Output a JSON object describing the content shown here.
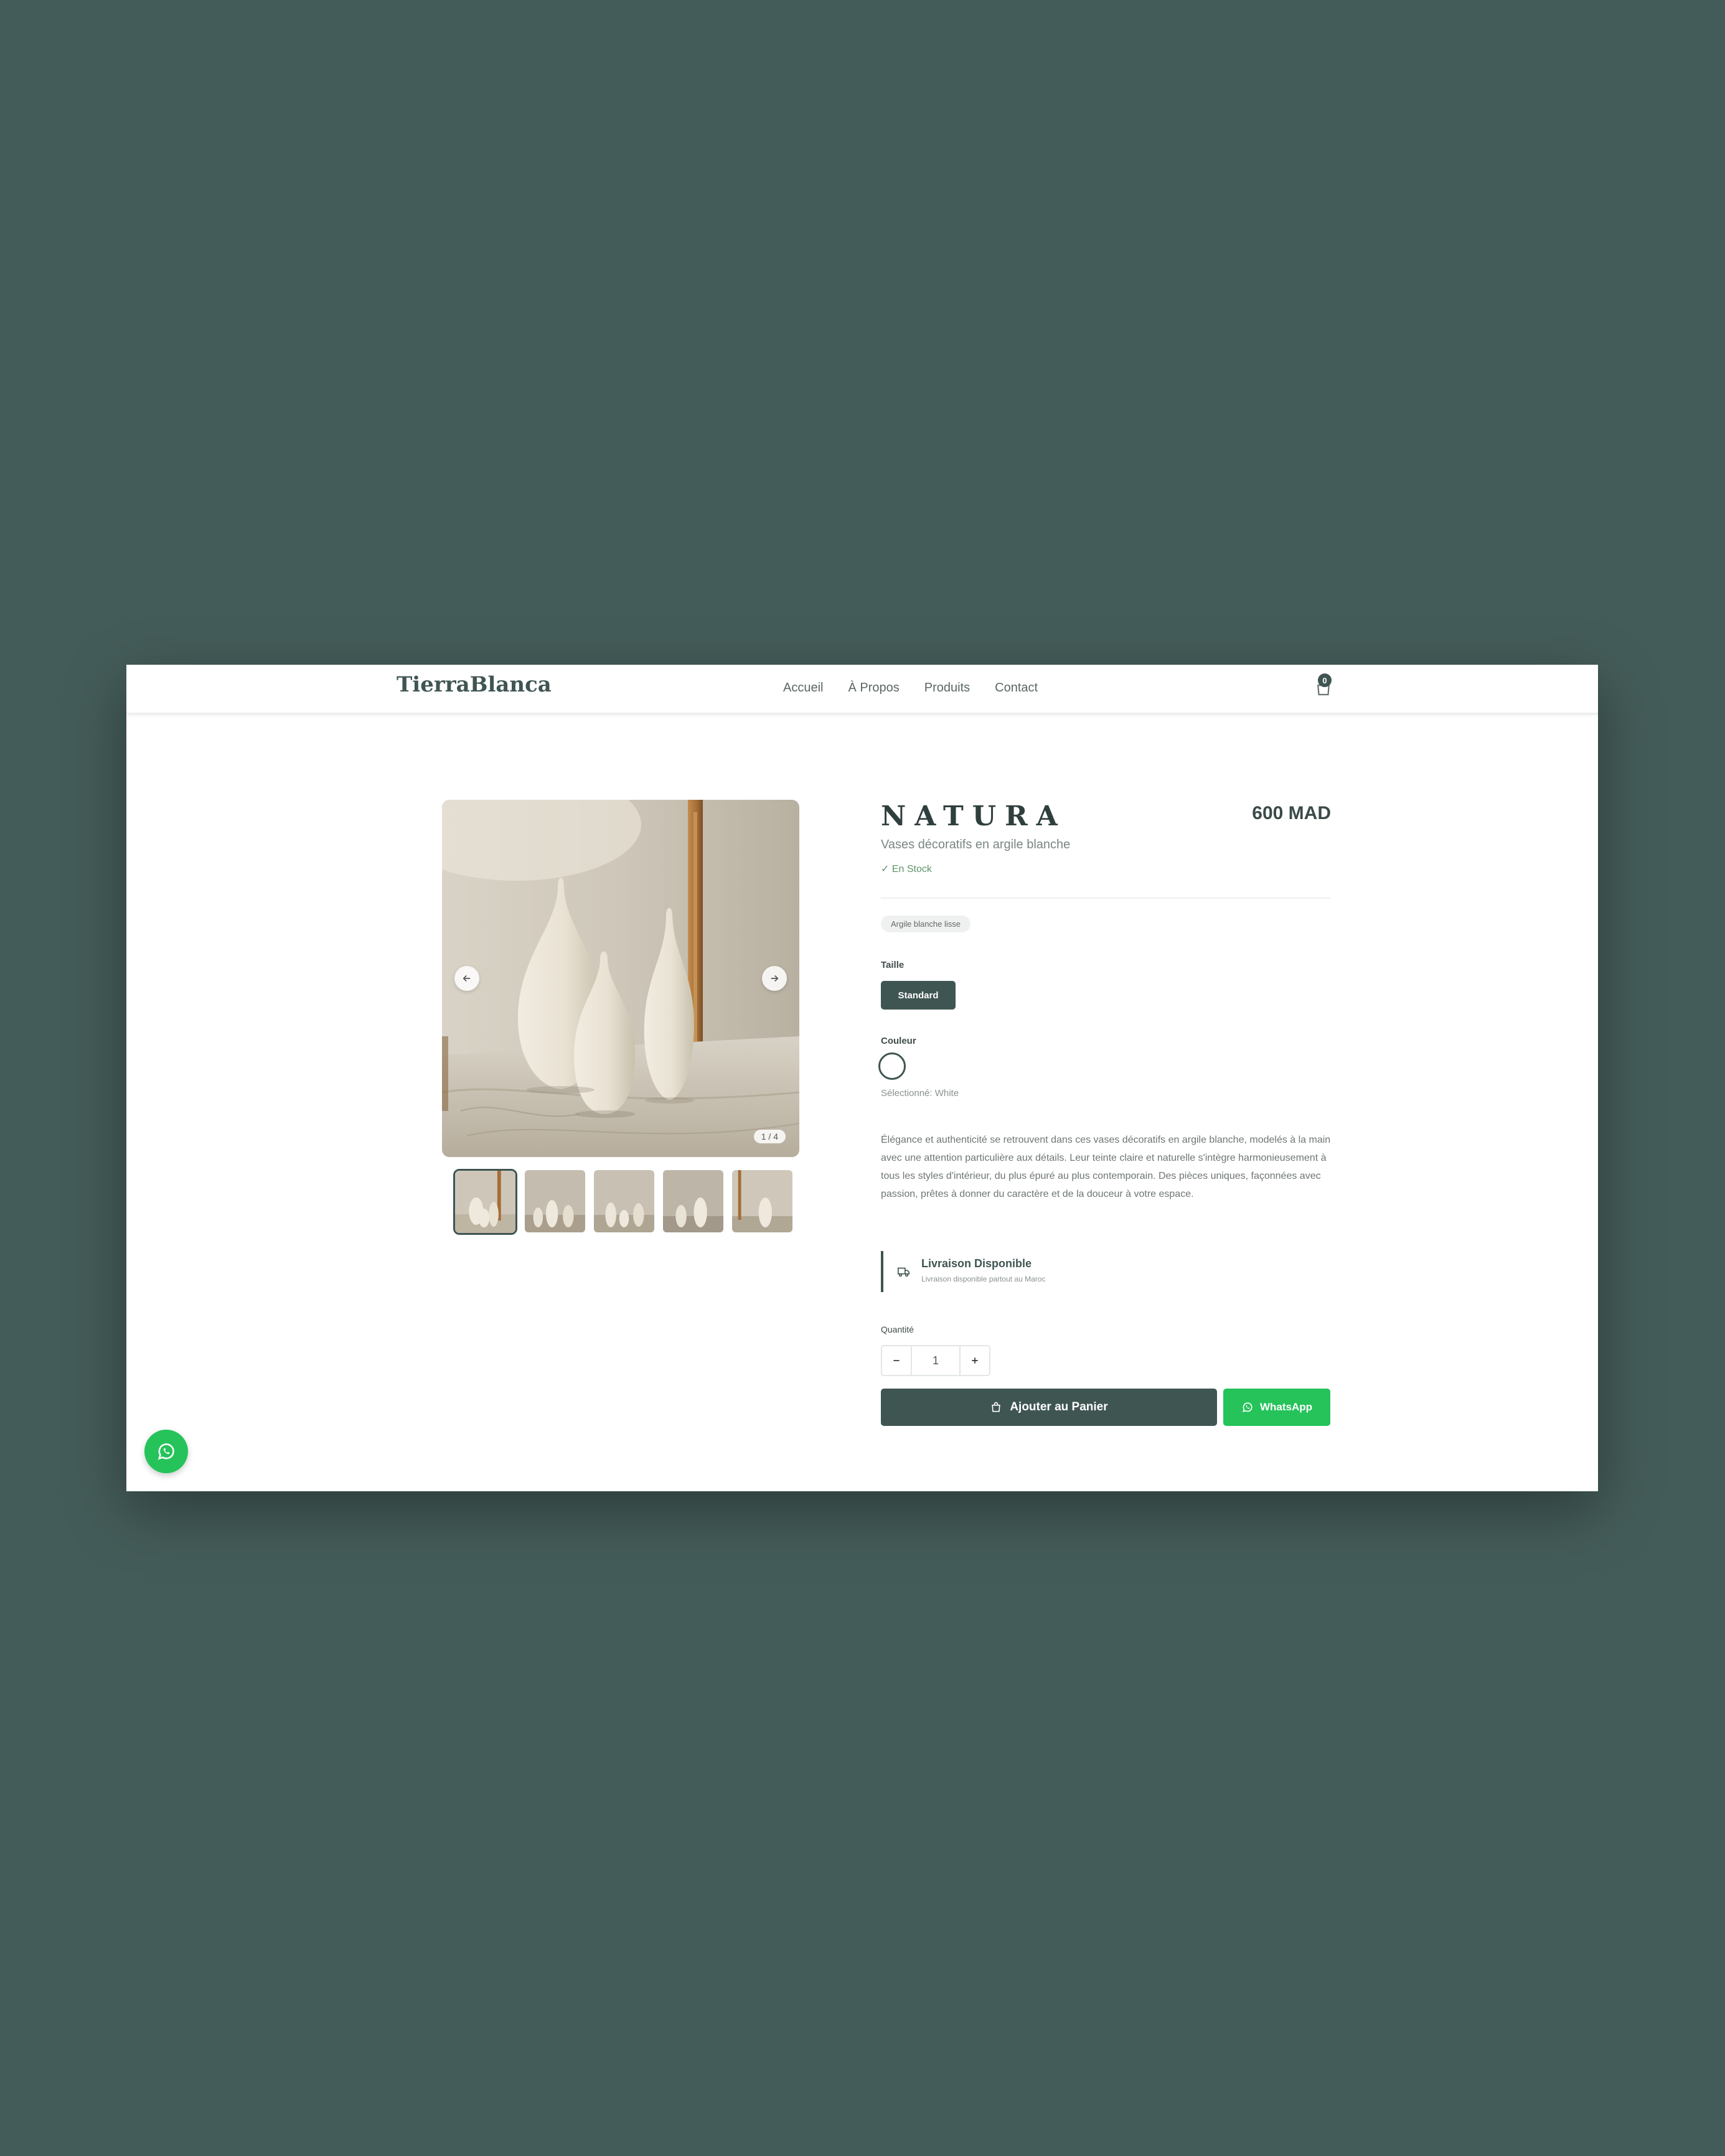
{
  "header": {
    "logo": "TierraBlanca",
    "nav": [
      "Accueil",
      "À Propos",
      "Produits",
      "Contact"
    ],
    "cart_count": "0"
  },
  "gallery": {
    "counter": "1 / 4",
    "thumbnail_count": 5
  },
  "product": {
    "title": "NATURA",
    "price": "600 MAD",
    "subtitle": "Vases décoratifs en argile blanche",
    "stock": "En Stock",
    "tag": "Argile blanche lisse",
    "size_label": "Taille",
    "size_value": "Standard",
    "color_label": "Couleur",
    "selected_color": "Sélectionné: White",
    "description": "Élégance et authenticité se retrouvent dans ces vases décoratifs en argile blanche, modelés à la main avec une attention particulière aux détails. Leur teinte claire et naturelle s'intègre harmonieusement à tous les styles d'intérieur, du plus épuré au plus contemporain. Des pièces uniques, façonnées avec passion, prêtes à donner du caractère et de la douceur à votre espace."
  },
  "delivery": {
    "title": "Livraison Disponible",
    "subtitle": "Livraison disponible partout au Maroc"
  },
  "quantity": {
    "label": "Quantité",
    "value": "1"
  },
  "actions": {
    "add_to_cart": "Ajouter au Panier",
    "whatsapp": "WhatsApp"
  },
  "colors": {
    "brand": "#3f5552",
    "whatsapp": "#25c35a",
    "background": "#445c59"
  }
}
